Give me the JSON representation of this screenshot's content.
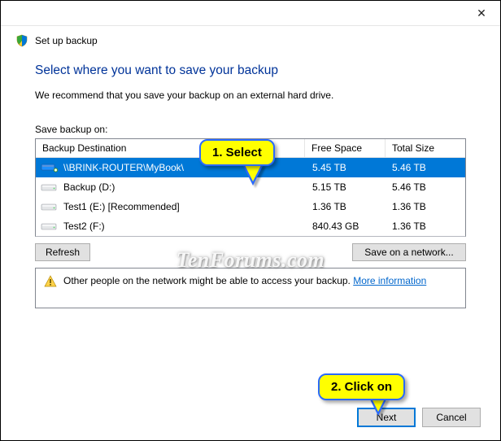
{
  "titlebar": {
    "close_glyph": "✕"
  },
  "header": {
    "icon": "shield-icon",
    "text": "Set up backup"
  },
  "main": {
    "headline": "Select where you want to save your backup",
    "recommendation": "We recommend that you save your backup on an external hard drive.",
    "list_label": "Save backup on:",
    "columns": {
      "destination": "Backup Destination",
      "free": "Free Space",
      "total": "Total Size"
    },
    "rows": [
      {
        "icon": "network-drive-icon",
        "name": "\\\\BRINK-ROUTER\\MyBook\\",
        "free": "5.45 TB",
        "total": "5.46 TB",
        "selected": true
      },
      {
        "icon": "hard-drive-icon",
        "name": "Backup (D:)",
        "free": "5.15 TB",
        "total": "5.46 TB",
        "selected": false
      },
      {
        "icon": "hard-drive-icon",
        "name": "Test1 (E:) [Recommended]",
        "free": "1.36 TB",
        "total": "1.36 TB",
        "selected": false
      },
      {
        "icon": "hard-drive-icon",
        "name": "Test2 (F:)",
        "free": "840.43 GB",
        "total": "1.36 TB",
        "selected": false
      }
    ],
    "refresh_btn": "Refresh",
    "network_btn": "Save on a network...",
    "warning_text": "Other people on the network might be able to access your backup. ",
    "warning_link": "More information"
  },
  "footer": {
    "next": "Next",
    "cancel": "Cancel"
  },
  "annotations": {
    "step1": "1. Select",
    "step2": "2. Click on"
  },
  "watermark": "TenForums.com",
  "colors": {
    "selection": "#0078d7",
    "link": "#0066cc",
    "headline": "#003399",
    "callout_fill": "#ffff00",
    "callout_border": "#2a6aff"
  }
}
